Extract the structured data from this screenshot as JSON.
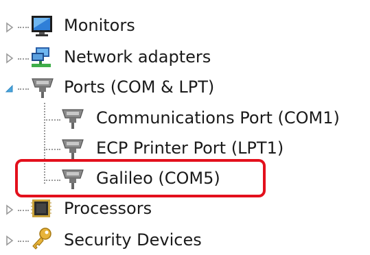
{
  "tree": {
    "items": [
      {
        "label": "Monitors",
        "icon": "monitor-icon",
        "expander": "collapsed"
      },
      {
        "label": "Network adapters",
        "icon": "network-adapter-icon",
        "expander": "collapsed"
      },
      {
        "label": "Ports (COM & LPT)",
        "icon": "port-icon",
        "expander": "expanded",
        "children": [
          {
            "label": "Communications Port (COM1)",
            "icon": "port-icon"
          },
          {
            "label": "ECP Printer Port (LPT1)",
            "icon": "port-icon"
          },
          {
            "label": "Galileo (COM5)",
            "icon": "port-icon",
            "highlighted": true
          }
        ]
      },
      {
        "label": "Processors",
        "icon": "processor-icon",
        "expander": "collapsed"
      },
      {
        "label": "Security Devices",
        "icon": "key-icon",
        "expander": "collapsed"
      }
    ]
  },
  "colors": {
    "highlight_border": "#e3101c",
    "expander_collapsed": "#9a9a9a",
    "expander_expanded": "#4aa6dd",
    "tree_lines": "#9a9a9a"
  }
}
